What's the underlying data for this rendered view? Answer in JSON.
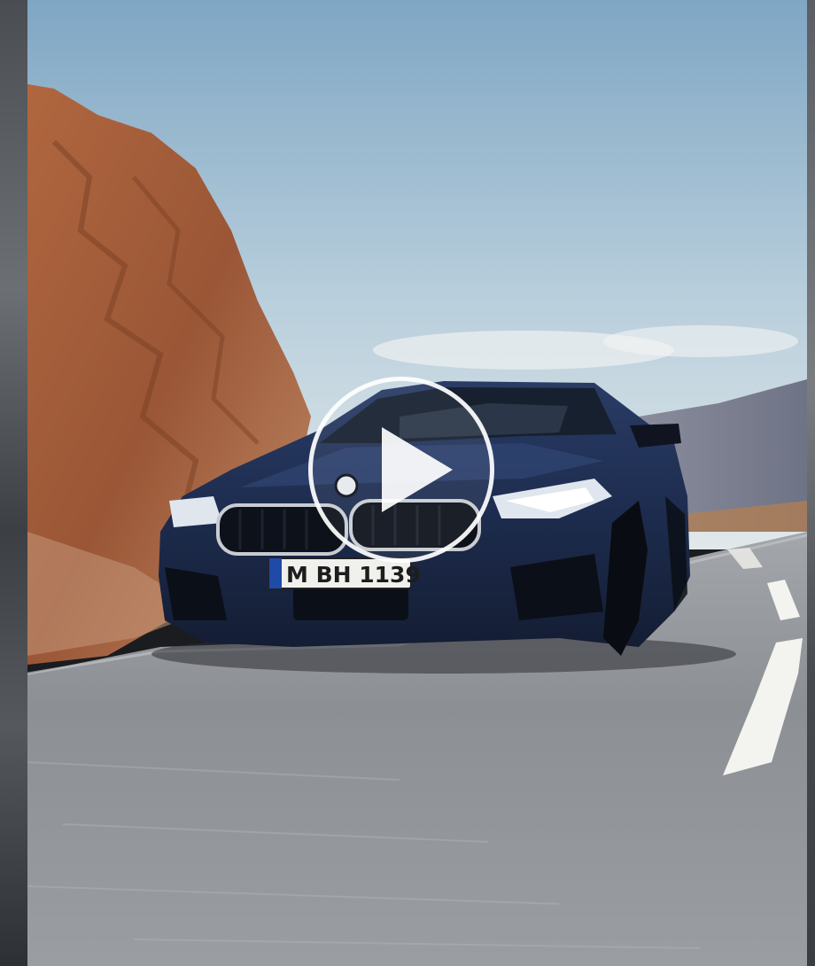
{
  "video": {
    "license_plate": "M BH 1139",
    "play_label": "Play video"
  },
  "colors": {
    "sky_top": "#7fa6c4",
    "sky_bottom": "#d6e2e8",
    "rock": "#a0593a",
    "car_body": "#1f2f52",
    "road": "#8f9398",
    "play_overlay": "#ffffff"
  },
  "icons": {
    "play": "play-icon"
  }
}
